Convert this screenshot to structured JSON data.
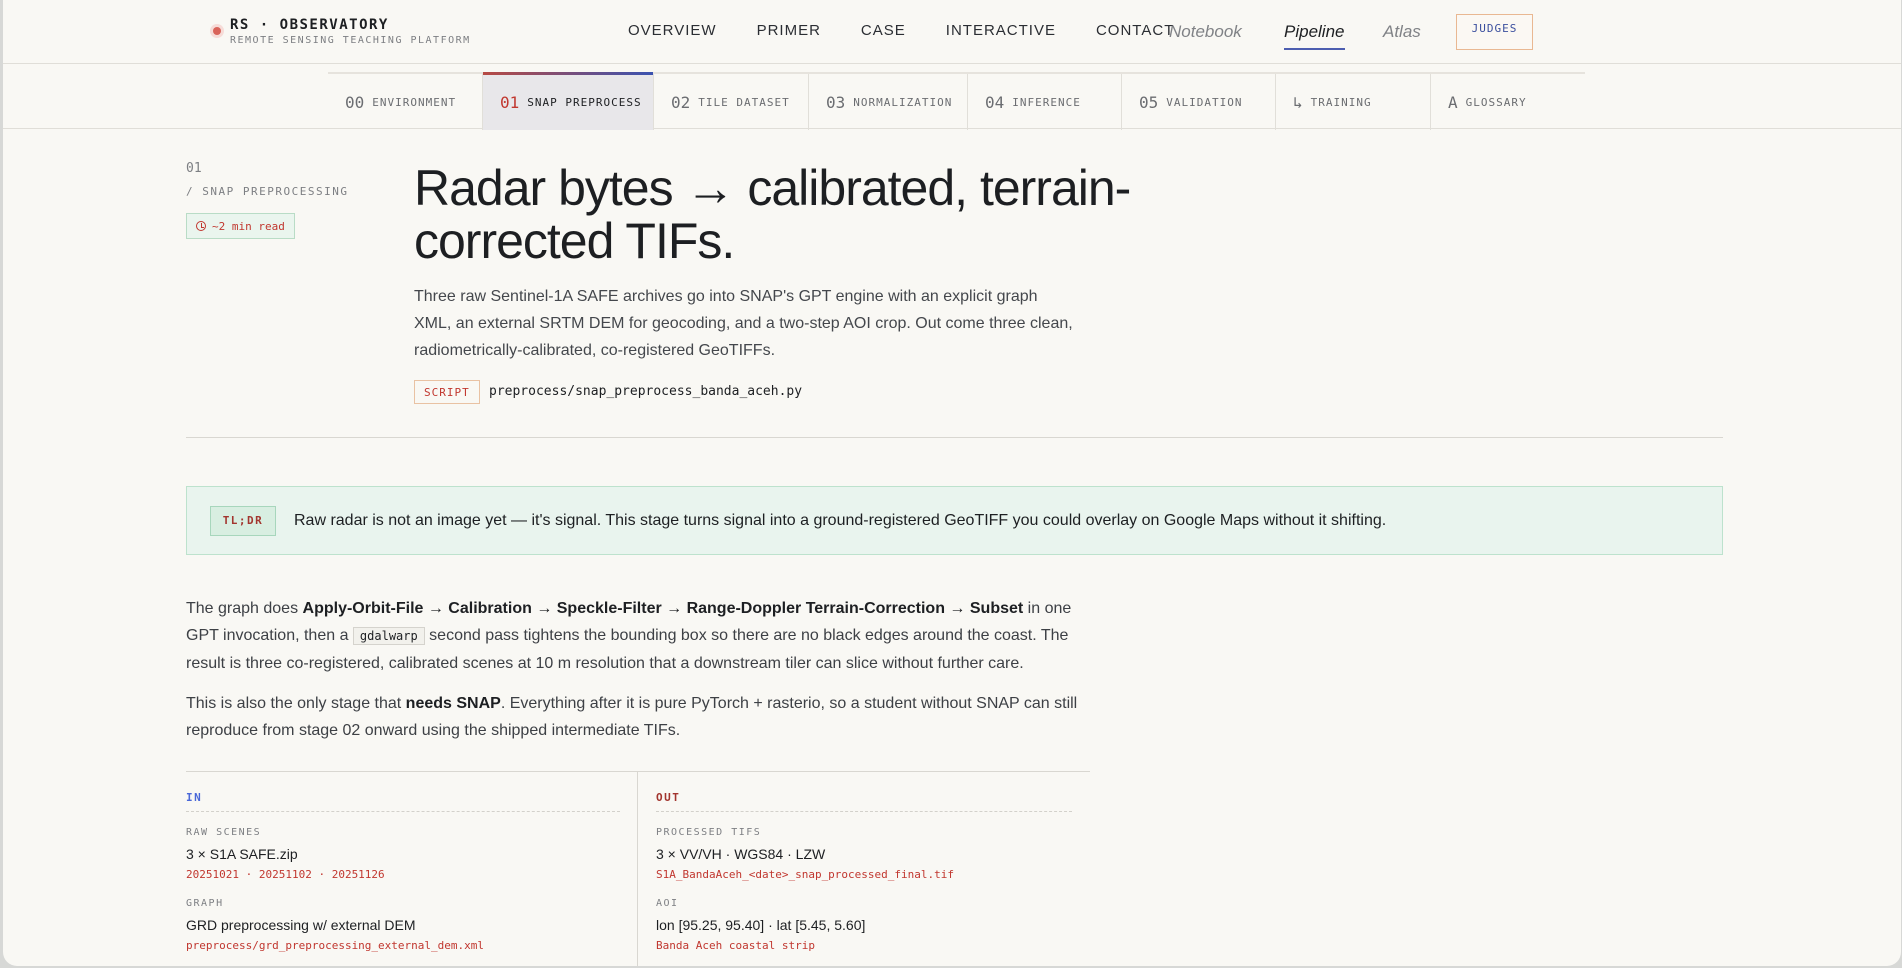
{
  "brand": {
    "title": "RS · OBSERVATORY",
    "subtitle": "REMOTE SENSING TEACHING PLATFORM"
  },
  "nav": {
    "links": [
      "OVERVIEW",
      "PRIMER",
      "CASE",
      "INTERACTIVE",
      "CONTACT"
    ],
    "modes": [
      "Notebook",
      "Pipeline",
      "Atlas"
    ],
    "active_mode": "Pipeline",
    "judges": "JUDGES"
  },
  "stages": [
    {
      "num": "00",
      "label": "ENVIRONMENT"
    },
    {
      "num": "01",
      "label": "SNAP PREPROCESS"
    },
    {
      "num": "02",
      "label": "TILE DATASET"
    },
    {
      "num": "03",
      "label": "NORMALIZATION"
    },
    {
      "num": "04",
      "label": "INFERENCE"
    },
    {
      "num": "05",
      "label": "VALIDATION"
    },
    {
      "num": "↳",
      "label": "TRAINING"
    },
    {
      "num": "A",
      "label": "GLOSSARY"
    }
  ],
  "active_stage": "01",
  "section": {
    "number": "01",
    "label": "/ SNAP PREPROCESSING",
    "read_time": "~2 min read",
    "title": "Radar bytes → calibrated, terrain-corrected TIFs.",
    "lede": "Three raw Sentinel-1A SAFE archives go into SNAP's GPT engine with an explicit graph XML, an external SRTM DEM for geocoding, and a two-step AOI crop. Out come three clean, radiometrically-calibrated, co-registered GeoTIFFs.",
    "script_tag": "SCRIPT",
    "script_path": "preprocess/snap_preprocess_banda_aceh.py"
  },
  "tldr": {
    "badge": "TL;DR",
    "text": "Raw radar is not an image yet — it's signal. This stage turns signal into a ground-registered GeoTIFF you could overlay on Google Maps without it shifting."
  },
  "body": {
    "p1_a": "The graph does ",
    "p1_b": "Apply-Orbit-File → Calibration → Speckle-Filter → Range-Doppler Terrain-Correction → Subset",
    "p1_c": " in one GPT invocation, then a ",
    "p1_code": "gdalwarp",
    "p1_d": " second pass tightens the bounding box so there are no black edges around the coast. The result is three co-registered, calibrated scenes at 10 m resolution that a downstream tiler can slice without further care.",
    "p2_a": "This is also the only stage that ",
    "p2_b": "needs SNAP",
    "p2_c": ". Everything after it is pure PyTorch + rasterio, so a student without SNAP can still reproduce from stage 02 onward using the shipped intermediate TIFs."
  },
  "io": {
    "in": {
      "head": "IN",
      "rows": [
        {
          "label": "RAW SCENES",
          "value": "3 × S1A SAFE.zip",
          "sub": "20251021 · 20251102 · 20251126"
        },
        {
          "label": "GRAPH",
          "value": "GRD preprocessing w/ external DEM",
          "sub": "preprocess/grd_preprocessing_external_dem.xml"
        }
      ]
    },
    "out": {
      "head": "OUT",
      "rows": [
        {
          "label": "PROCESSED TIFS",
          "value": "3 × VV/VH · WGS84 · LZW",
          "sub": "S1A_BandaAceh_<date>_snap_processed_final.tif"
        },
        {
          "label": "AOI",
          "value": "lon [95.25, 95.40] · lat [5.45, 5.60]",
          "sub": "Banda Aceh coastal strip"
        }
      ]
    }
  },
  "colors": {
    "accent_red": "#c1372f",
    "accent_blue": "#3a52b0",
    "tldr_bg": "#e9f4ee",
    "page_bg": "#f9f8f4"
  }
}
